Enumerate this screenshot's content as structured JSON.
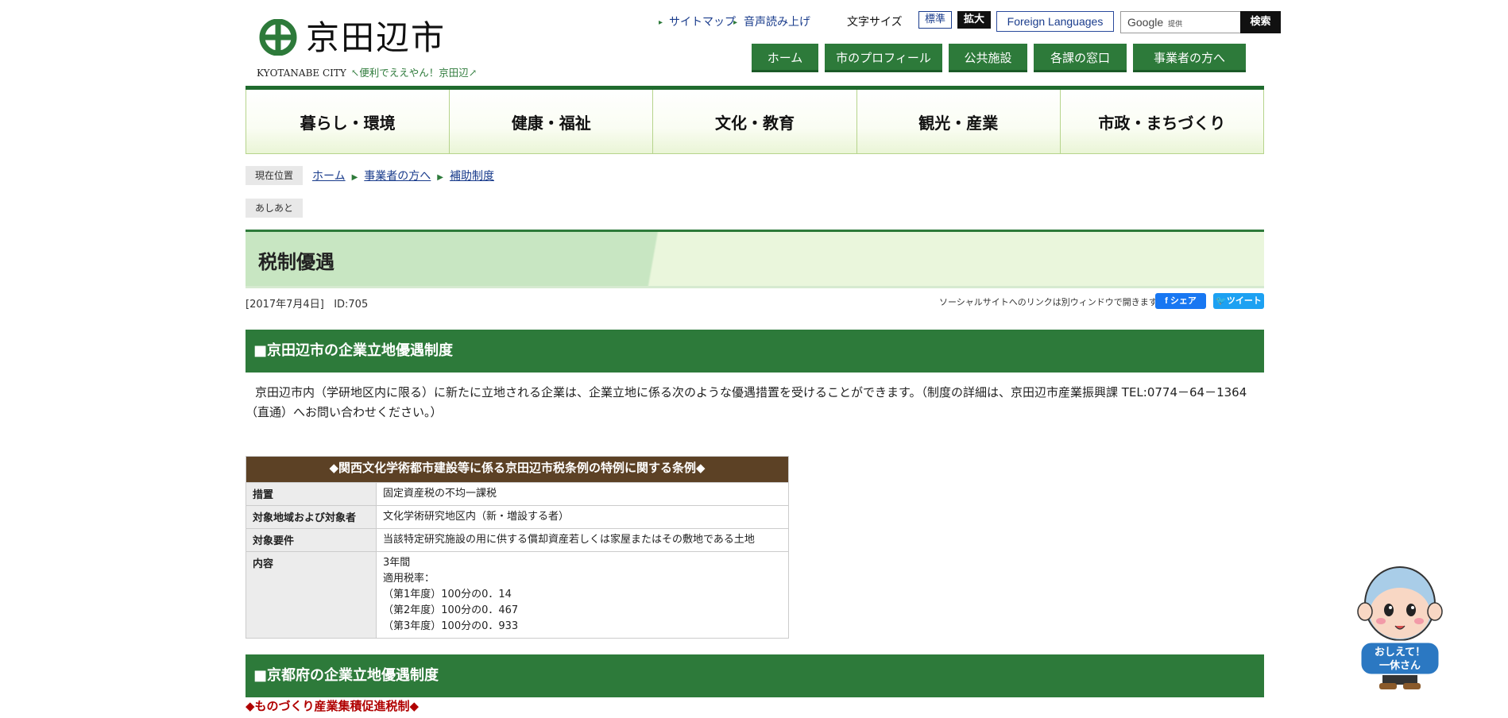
{
  "header": {
    "city_name": "京田辺市",
    "city_en": "KYOTANABE CITY",
    "tagline": "↖便利でええやん！京田辺↗",
    "util_links": [
      "サイトマップ",
      "音声読み上げ"
    ],
    "font_size_label": "文字サイズ",
    "font_normal": "標準",
    "font_large": "拡大",
    "foreign": "Foreign Languages",
    "search_placeholder": "Google",
    "search_sub": "提供",
    "search_button": "検索",
    "top_nav": [
      "ホーム",
      "市のプロフィール",
      "公共施設",
      "各課の窓口",
      "事業者の方へ"
    ]
  },
  "global_nav": [
    "暮らし・環境",
    "健康・福祉",
    "文化・教育",
    "観光・産業",
    "市政・まちづくり"
  ],
  "breadcrumb": {
    "label": "現在位置",
    "items": [
      "ホーム",
      "事業者の方へ",
      "補助制度"
    ],
    "footprint": "あしあと"
  },
  "page": {
    "title": "税制優遇",
    "date": "[2017年7月4日]",
    "id": "ID:705",
    "social_note": "ソーシャルサイトへのリンクは別ウィンドウで開きます",
    "share_fb": "シェア",
    "share_tw": "ツイート"
  },
  "section1": {
    "heading": "■京田辺市の企業立地優遇制度",
    "intro": "京田辺市内（学研地区内に限る）に新たに立地される企業は、企業立地に係る次のような優遇措置を受けることができます。（制度の詳細は、京田辺市産業振興課 TEL:0774－64－1364（直通）へお問い合わせください。）",
    "table": {
      "caption": "◆関西文化学術都市建設等に係る京田辺市税条例の特例に関する条例◆",
      "rows": [
        {
          "h": "措置",
          "v": [
            "固定資産税の不均一課税"
          ]
        },
        {
          "h": "対象地域および対象者",
          "v": [
            "文化学術研究地区内（新・増設する者）"
          ]
        },
        {
          "h": "対象要件",
          "v": [
            "当該特定研究施設の用に供する償却資産若しくは家屋またはその敷地である土地"
          ]
        },
        {
          "h": "内容",
          "v": [
            "3年間",
            "適用税率：",
            "（第1年度）100分の0．14",
            "（第2年度）100分の0．467",
            "（第3年度）100分の0．933"
          ]
        }
      ]
    }
  },
  "section2": {
    "heading": "■京都府の企業立地優遇制度",
    "subhead": "◆ものづくり産業集積促進税制◆"
  },
  "mascot": {
    "line1": "おしえて！",
    "line2": "一休さん"
  }
}
